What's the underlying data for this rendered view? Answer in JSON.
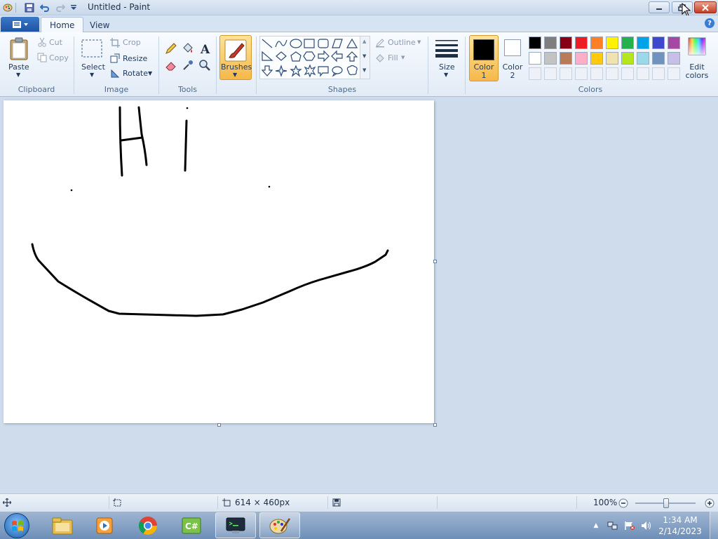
{
  "window": {
    "title": "Untitled - Paint"
  },
  "tabs": {
    "home": "Home",
    "view": "View"
  },
  "clipboard": {
    "paste": "Paste",
    "cut": "Cut",
    "copy": "Copy",
    "group": "Clipboard"
  },
  "image": {
    "select": "Select",
    "crop": "Crop",
    "resize": "Resize",
    "rotate": "Rotate",
    "group": "Image"
  },
  "tools": {
    "group": "Tools"
  },
  "brushes": {
    "label": "Brushes"
  },
  "shapes": {
    "outline": "Outline",
    "fill": "Fill",
    "group": "Shapes"
  },
  "size": {
    "label": "Size"
  },
  "colors": {
    "color1_line1": "Color",
    "color1_line2": "1",
    "color2_line1": "Color",
    "color2_line2": "2",
    "edit_line1": "Edit",
    "edit_line2": "colors",
    "group": "Colors",
    "color1_value": "#000000",
    "color2_value": "#ffffff",
    "palette_row1": [
      "#000000",
      "#7f7f7f",
      "#880015",
      "#ed1c24",
      "#ff7f27",
      "#fff200",
      "#22b14c",
      "#00a2e8",
      "#3f48cc",
      "#a349a4"
    ],
    "palette_row2": [
      "#ffffff",
      "#c3c3c3",
      "#b97a57",
      "#ffaec9",
      "#ffc90e",
      "#efe4b0",
      "#b5e61d",
      "#99d9ea",
      "#7092be",
      "#c8bfe7"
    ]
  },
  "statusbar": {
    "dimensions": "614 × 460px",
    "zoom": "100%"
  },
  "taskbar": {
    "time": "1:34 AM",
    "date": "2/14/2023"
  }
}
